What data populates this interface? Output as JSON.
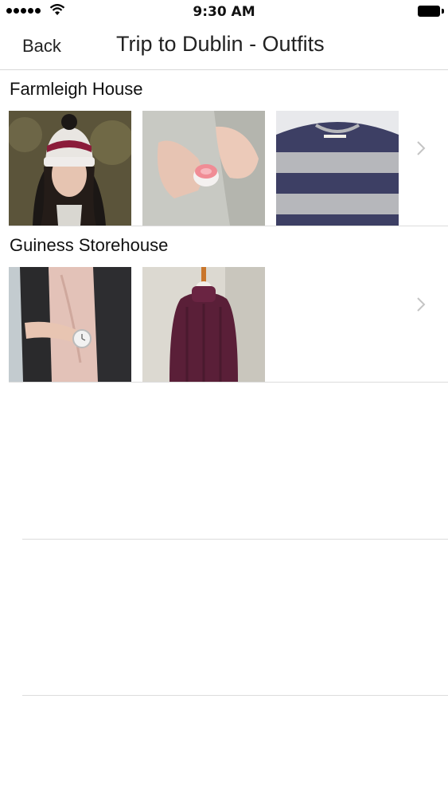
{
  "status_bar": {
    "time": "9:30 AM",
    "signal_dots": 5,
    "icons": [
      "signal-dots-icon",
      "wifi-icon",
      "battery-icon"
    ]
  },
  "nav": {
    "back_label": "Back",
    "title": "Trip to Dublin - Outfits"
  },
  "sections": [
    {
      "title": "Farmleigh House",
      "items": [
        "beanie-photo",
        "lip-balm-photo",
        "striped-sweater-photo"
      ]
    },
    {
      "title": "Guiness Storehouse",
      "items": [
        "leather-jacket-watch-photo",
        "burgundy-turtleneck-photo"
      ]
    }
  ],
  "colors": {
    "divider": "#dcdcdc",
    "chevron": "#c4c4c4",
    "text": "#111111"
  }
}
